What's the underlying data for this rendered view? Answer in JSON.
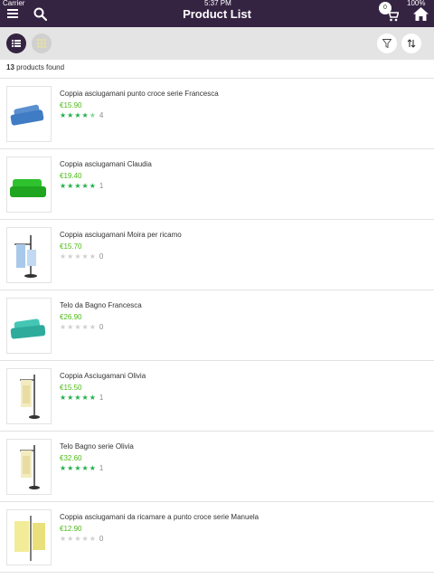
{
  "status": {
    "carrier": "Carrier",
    "time": "5:37 PM",
    "battery": "100%"
  },
  "header": {
    "title": "Product List",
    "cart_count": "0"
  },
  "list": {
    "count": "13",
    "count_label": "products found"
  },
  "products": [
    {
      "name": "Coppia asciugamani punto croce serie Francesca",
      "price": "€15.90",
      "stars": "★★★★",
      "half": "★",
      "stars_off": "",
      "rating_count": "4",
      "thumb": "towel-blue"
    },
    {
      "name": "Coppia asciugamani Claudia",
      "price": "€19.40",
      "stars": "★★★★★",
      "half": "",
      "stars_off": "",
      "rating_count": "1",
      "thumb": "towel-green"
    },
    {
      "name": "Coppia asciugamani Moira per ricamo",
      "price": "€15.70",
      "stars": "",
      "half": "",
      "stars_off": "★★★★★",
      "rating_count": "0",
      "thumb": "stand-blue"
    },
    {
      "name": "Telo da Bagno Francesca",
      "price": "€26.90",
      "stars": "",
      "half": "",
      "stars_off": "★★★★★",
      "rating_count": "0",
      "thumb": "towel-teal"
    },
    {
      "name": "Coppia Asciugamani Olivia",
      "price": "€15.50",
      "stars": "★★★★★",
      "half": "",
      "stars_off": "",
      "rating_count": "1",
      "thumb": "stand-cream"
    },
    {
      "name": "Telo Bagno serie Olivia",
      "price": "€32.60",
      "stars": "★★★★★",
      "half": "",
      "stars_off": "",
      "rating_count": "1",
      "thumb": "stand-cream"
    },
    {
      "name": "Coppia asciugamani da ricamare a punto croce serie Manuela",
      "price": "€12.90",
      "stars": "",
      "half": "",
      "stars_off": "★★★★★",
      "rating_count": "0",
      "thumb": "stand-yellow"
    }
  ],
  "colors": {
    "header": "#352342",
    "price": "#4cbb17",
    "star": "#21b14a",
    "toolbar": "#e4e4e4"
  },
  "icons": {
    "menu": "hamburger-icon",
    "search": "search-icon",
    "cart": "cart-icon",
    "home": "home-icon",
    "list_view": "list-view-icon",
    "grid_view": "grid-view-icon",
    "filter": "filter-icon",
    "sort": "sort-icon"
  }
}
